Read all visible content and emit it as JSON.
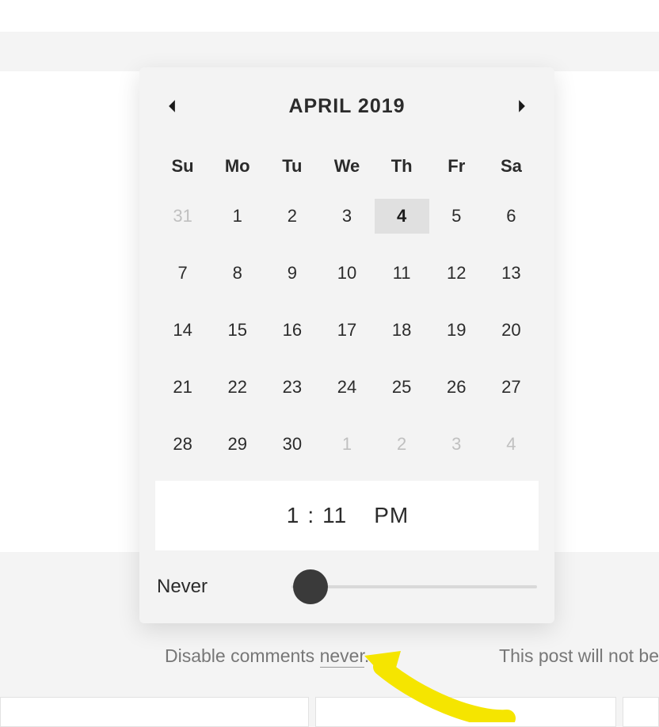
{
  "calendar": {
    "title": "APRIL 2019",
    "dow": [
      "Su",
      "Mo",
      "Tu",
      "We",
      "Th",
      "Fr",
      "Sa"
    ],
    "cells": [
      {
        "n": "31",
        "muted": true
      },
      {
        "n": "1"
      },
      {
        "n": "2"
      },
      {
        "n": "3"
      },
      {
        "n": "4",
        "selected": true
      },
      {
        "n": "5"
      },
      {
        "n": "6"
      },
      {
        "n": "7"
      },
      {
        "n": "8"
      },
      {
        "n": "9"
      },
      {
        "n": "10"
      },
      {
        "n": "11"
      },
      {
        "n": "12"
      },
      {
        "n": "13"
      },
      {
        "n": "14"
      },
      {
        "n": "15"
      },
      {
        "n": "16"
      },
      {
        "n": "17"
      },
      {
        "n": "18"
      },
      {
        "n": "19"
      },
      {
        "n": "20"
      },
      {
        "n": "21"
      },
      {
        "n": "22"
      },
      {
        "n": "23"
      },
      {
        "n": "24"
      },
      {
        "n": "25"
      },
      {
        "n": "26"
      },
      {
        "n": "27"
      },
      {
        "n": "28"
      },
      {
        "n": "29"
      },
      {
        "n": "30"
      },
      {
        "n": "1",
        "muted": true
      },
      {
        "n": "2",
        "muted": true
      },
      {
        "n": "3",
        "muted": true
      },
      {
        "n": "4",
        "muted": true
      }
    ]
  },
  "time": {
    "hour": "1",
    "colon": ":",
    "minute": "11",
    "ampm": "PM"
  },
  "slider": {
    "label": "Never"
  },
  "caption": {
    "prefix": "Disable comments ",
    "link": "never",
    "suffix": ".",
    "right": "This post will not be"
  }
}
